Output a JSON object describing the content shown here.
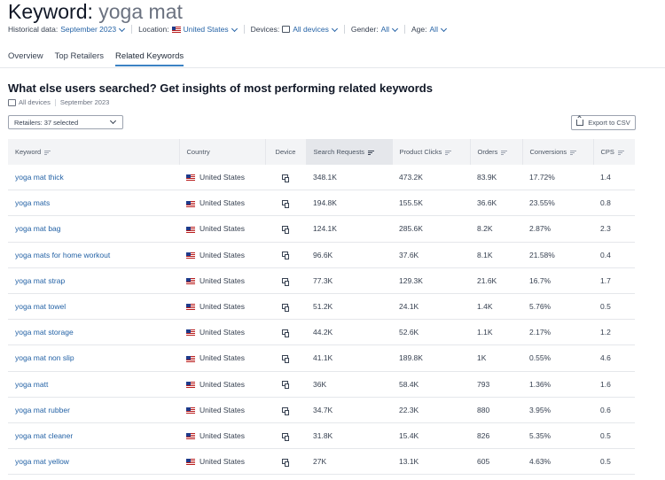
{
  "header": {
    "title_prefix": "Keyword:",
    "keyword": "yoga mat"
  },
  "filters": {
    "historical_label": "Historical data:",
    "historical_value": "September 2023",
    "location_label": "Location:",
    "location_value": "United States",
    "devices_label": "Devices:",
    "devices_value": "All devices",
    "gender_label": "Gender:",
    "gender_value": "All",
    "age_label": "Age:",
    "age_value": "All"
  },
  "tabs": [
    {
      "label": "Overview",
      "active": false
    },
    {
      "label": "Top Retailers",
      "active": false
    },
    {
      "label": "Related Keywords",
      "active": true
    }
  ],
  "section": {
    "title": "What else users searched? Get insights of most performing related keywords",
    "devices": "All devices",
    "period": "September 2023"
  },
  "retailer_select": {
    "value": "Retailers: 37 selected"
  },
  "export_button": {
    "label": "Export to CSV"
  },
  "table": {
    "columns": [
      "Keyword",
      "Country",
      "Device",
      "Search Requests",
      "Product Clicks",
      "Orders",
      "Conversions",
      "CPS"
    ],
    "rows": [
      [
        "yoga mat thick",
        "United States",
        "348.1K",
        "473.2K",
        "83.9K",
        "17.72%",
        "1.4"
      ],
      [
        "yoga mats",
        "United States",
        "194.8K",
        "155.5K",
        "36.6K",
        "23.55%",
        "0.8"
      ],
      [
        "yoga mat bag",
        "United States",
        "124.1K",
        "285.6K",
        "8.2K",
        "2.87%",
        "2.3"
      ],
      [
        "yoga mats for home workout",
        "United States",
        "96.6K",
        "37.6K",
        "8.1K",
        "21.58%",
        "0.4"
      ],
      [
        "yoga mat strap",
        "United States",
        "77.3K",
        "129.3K",
        "21.6K",
        "16.7%",
        "1.7"
      ],
      [
        "yoga mat towel",
        "United States",
        "51.2K",
        "24.1K",
        "1.4K",
        "5.76%",
        "0.5"
      ],
      [
        "yoga mat storage",
        "United States",
        "44.2K",
        "52.6K",
        "1.1K",
        "2.17%",
        "1.2"
      ],
      [
        "yoga mat non slip",
        "United States",
        "41.1K",
        "189.8K",
        "1K",
        "0.55%",
        "4.6"
      ],
      [
        "yoga matt",
        "United States",
        "36K",
        "58.4K",
        "793",
        "1.36%",
        "1.6"
      ],
      [
        "yoga mat rubber",
        "United States",
        "34.7K",
        "22.3K",
        "880",
        "3.95%",
        "0.6"
      ],
      [
        "yoga mat cleaner",
        "United States",
        "31.8K",
        "15.4K",
        "826",
        "5.35%",
        "0.5"
      ],
      [
        "yoga mat yellow",
        "United States",
        "27K",
        "13.1K",
        "605",
        "4.63%",
        "0.5"
      ]
    ]
  },
  "colors": {
    "link": "#2563a6",
    "accent_underline": "#3b82c4",
    "header_bg": "#f3f4f6",
    "sorted_header_bg": "#e5e7eb"
  }
}
